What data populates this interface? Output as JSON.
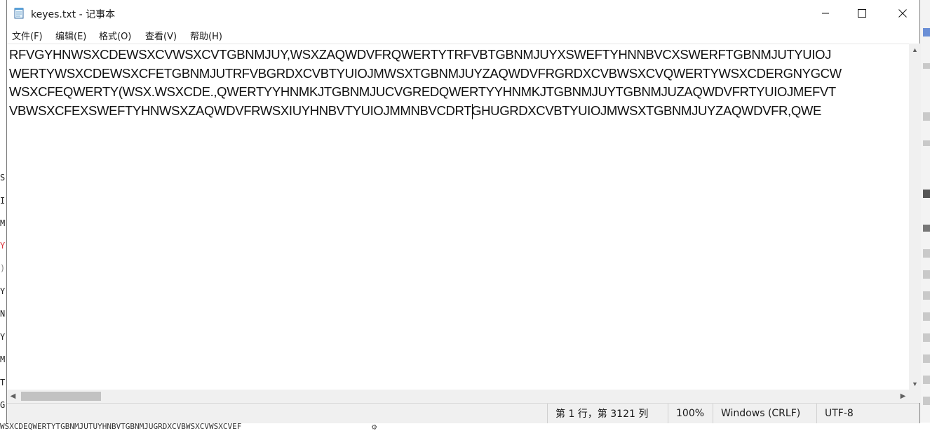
{
  "window": {
    "title": "keyes.txt - 记事本",
    "controls": {
      "minimize": "minimize-icon",
      "maximize": "maximize-icon",
      "close": "close-icon"
    }
  },
  "menu": [
    {
      "label": "文件(F)"
    },
    {
      "label": "编辑(E)"
    },
    {
      "label": "格式(O)"
    },
    {
      "label": "查看(V)"
    },
    {
      "label": "帮助(H)"
    }
  ],
  "document": {
    "lines": [
      "RFVGYHNWSXCDEWSXCVWSXCVTGBNMJUY,WSXZAQWDVFRQWERTYTRFVBTGBNMJUYXSWEFTYHNNBVCXSWERFTGBNMJUTYUIOJ",
      "WERTYWSXCDEWSXCFETGBNMJUTRFVBGRDXCVBTYUIOJMWSXTGBNMJUYZAQWDVFRGRDXCVBWSXCVQWERTYWSXCDERGNYGCW",
      "WSXCFEQWERTY(WSX.WSXCDE.,QWERTYYHNMKJTGBNMJUCVGREDQWERTYYHNMKJTGBNMJUYTGBNMJUZAQWDVFRTYUIOJMEFVT",
      "VBWSXCFEXSWEFTYHNWSXZAQWDVFRWSXIUYHNBVTYUIOJMMNBVCDRTGHUGRDXCVBTYUIOJMWSXTGBNMJUYZAQWDVFR,QWE"
    ]
  },
  "status": {
    "position": "第 1 行，第 3121 列",
    "zoom": "100%",
    "line_ending": "Windows (CRLF)",
    "encoding": "UTF-8"
  },
  "background": {
    "left_chars": [
      "S",
      "I",
      "M",
      "Y",
      ")",
      "Y",
      "N",
      "Y",
      "M",
      "T",
      "G"
    ],
    "left_highlight_color": "#d9363e",
    "bottom_text": "WSXCDEQWERTYTGBNMJUTUYHNBVTGBNMJUGRDXCVBWSXCVWSXCVEF",
    "bottom_icon": "gear-icon"
  },
  "colors": {
    "window_bg": "#ffffff",
    "chrome_bg": "#f0f0f0",
    "scroll_thumb": "#c2c2c2",
    "text": "#111111"
  }
}
